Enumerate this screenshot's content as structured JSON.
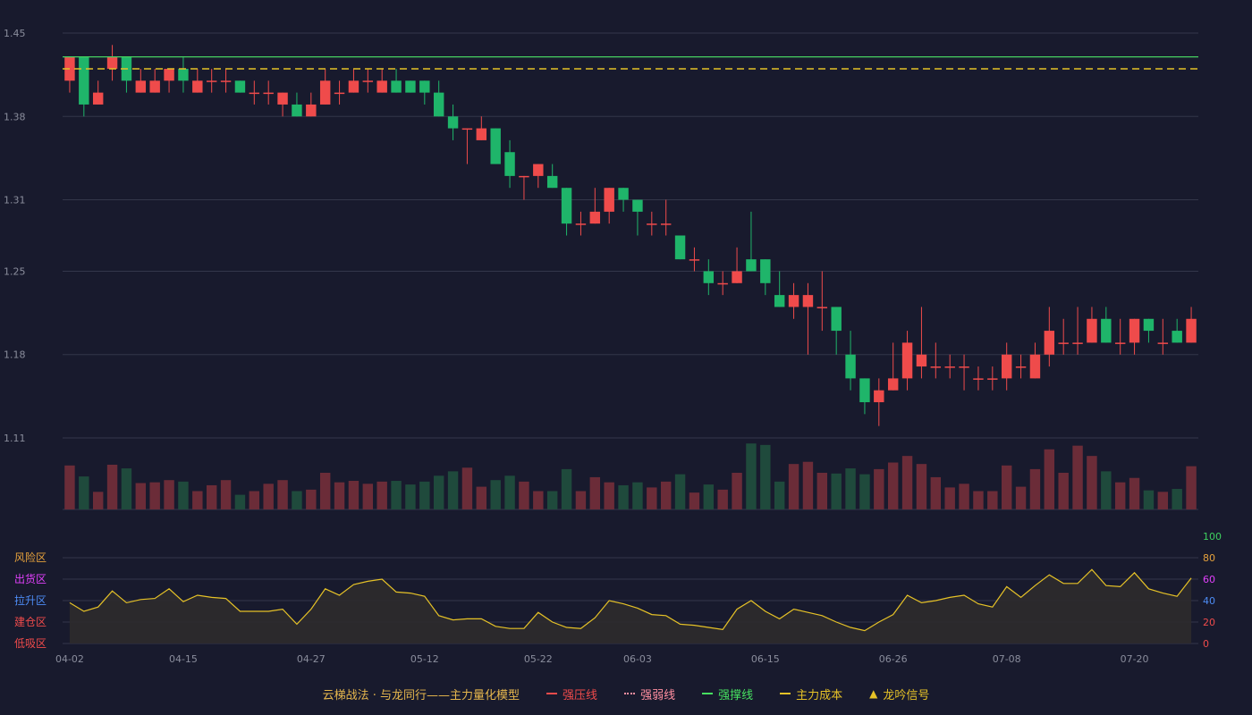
{
  "chart_data": {
    "type": "candlestick",
    "x_dates": [
      "04-02",
      "04-03",
      "04-07",
      "04-08",
      "04-09",
      "04-10",
      "04-11",
      "04-14",
      "04-15",
      "04-16",
      "04-17",
      "04-18",
      "04-21",
      "04-22",
      "04-23",
      "04-24",
      "04-25",
      "04-27",
      "04-28",
      "04-29",
      "04-30",
      "05-06",
      "05-07",
      "05-08",
      "05-09",
      "05-12",
      "05-13",
      "05-14",
      "05-15",
      "05-16",
      "05-19",
      "05-20",
      "05-21",
      "05-22",
      "05-23",
      "05-26",
      "05-27",
      "05-28",
      "05-29",
      "05-30",
      "06-03",
      "06-04",
      "06-05",
      "06-06",
      "06-09",
      "06-10",
      "06-11",
      "06-12",
      "06-13",
      "06-15",
      "06-16",
      "06-17",
      "06-18",
      "06-19",
      "06-20",
      "06-23",
      "06-24",
      "06-25",
      "06-26",
      "06-27",
      "06-30",
      "07-01",
      "07-02",
      "07-03",
      "07-04",
      "07-07",
      "07-08",
      "07-09",
      "07-10",
      "07-11",
      "07-14",
      "07-15",
      "07-16",
      "07-17",
      "07-18",
      "07-20",
      "07-21",
      "07-22",
      "07-23",
      "07-24",
      "07-25",
      "07-28"
    ],
    "x_tick_labels": [
      "04-02",
      "04-15",
      "04-27",
      "05-12",
      "05-22",
      "06-03",
      "06-15",
      "06-26",
      "07-08",
      "07-20"
    ],
    "price_axis": {
      "ticks": [
        1.11,
        1.18,
        1.25,
        1.31,
        1.38,
        1.45
      ],
      "min": 1.11,
      "max": 1.46
    },
    "indicator_axis": {
      "ticks": [
        0,
        20,
        40,
        60,
        80,
        100
      ]
    },
    "zone_labels": [
      "风险区",
      "出货区",
      "拉升区",
      "建仓区",
      "低吸区"
    ],
    "ohlc": [
      [
        1.41,
        1.43,
        1.4,
        1.43
      ],
      [
        1.43,
        1.43,
        1.38,
        1.39
      ],
      [
        1.39,
        1.41,
        1.39,
        1.4
      ],
      [
        1.42,
        1.44,
        1.41,
        1.43
      ],
      [
        1.43,
        1.43,
        1.4,
        1.41
      ],
      [
        1.4,
        1.42,
        1.4,
        1.41
      ],
      [
        1.4,
        1.42,
        1.4,
        1.41
      ],
      [
        1.41,
        1.42,
        1.4,
        1.42
      ],
      [
        1.42,
        1.43,
        1.4,
        1.41
      ],
      [
        1.4,
        1.42,
        1.4,
        1.41
      ],
      [
        1.41,
        1.42,
        1.4,
        1.41
      ],
      [
        1.41,
        1.42,
        1.4,
        1.41
      ],
      [
        1.41,
        1.41,
        1.4,
        1.4
      ],
      [
        1.4,
        1.41,
        1.39,
        1.4
      ],
      [
        1.4,
        1.41,
        1.39,
        1.4
      ],
      [
        1.39,
        1.4,
        1.38,
        1.4
      ],
      [
        1.39,
        1.4,
        1.38,
        1.38
      ],
      [
        1.38,
        1.4,
        1.38,
        1.39
      ],
      [
        1.39,
        1.42,
        1.39,
        1.41
      ],
      [
        1.4,
        1.41,
        1.39,
        1.4
      ],
      [
        1.4,
        1.42,
        1.4,
        1.41
      ],
      [
        1.41,
        1.42,
        1.4,
        1.41
      ],
      [
        1.4,
        1.42,
        1.4,
        1.41
      ],
      [
        1.41,
        1.42,
        1.4,
        1.4
      ],
      [
        1.41,
        1.41,
        1.4,
        1.4
      ],
      [
        1.41,
        1.41,
        1.39,
        1.4
      ],
      [
        1.4,
        1.41,
        1.38,
        1.38
      ],
      [
        1.38,
        1.39,
        1.36,
        1.37
      ],
      [
        1.37,
        1.37,
        1.34,
        1.37
      ],
      [
        1.36,
        1.38,
        1.36,
        1.37
      ],
      [
        1.37,
        1.37,
        1.34,
        1.34
      ],
      [
        1.35,
        1.36,
        1.32,
        1.33
      ],
      [
        1.33,
        1.33,
        1.31,
        1.33
      ],
      [
        1.33,
        1.34,
        1.32,
        1.34
      ],
      [
        1.33,
        1.34,
        1.32,
        1.32
      ],
      [
        1.32,
        1.32,
        1.28,
        1.29
      ],
      [
        1.29,
        1.3,
        1.28,
        1.29
      ],
      [
        1.29,
        1.32,
        1.29,
        1.3
      ],
      [
        1.3,
        1.32,
        1.29,
        1.32
      ],
      [
        1.32,
        1.32,
        1.3,
        1.31
      ],
      [
        1.31,
        1.31,
        1.28,
        1.3
      ],
      [
        1.29,
        1.3,
        1.28,
        1.29
      ],
      [
        1.29,
        1.31,
        1.28,
        1.29
      ],
      [
        1.28,
        1.28,
        1.26,
        1.26
      ],
      [
        1.26,
        1.27,
        1.25,
        1.26
      ],
      [
        1.25,
        1.26,
        1.23,
        1.24
      ],
      [
        1.24,
        1.25,
        1.23,
        1.24
      ],
      [
        1.24,
        1.27,
        1.24,
        1.25
      ],
      [
        1.26,
        1.3,
        1.25,
        1.25
      ],
      [
        1.26,
        1.26,
        1.23,
        1.24
      ],
      [
        1.23,
        1.25,
        1.22,
        1.22
      ],
      [
        1.22,
        1.24,
        1.21,
        1.23
      ],
      [
        1.22,
        1.24,
        1.18,
        1.23
      ],
      [
        1.22,
        1.25,
        1.2,
        1.22
      ],
      [
        1.22,
        1.22,
        1.18,
        1.2
      ],
      [
        1.18,
        1.2,
        1.15,
        1.16
      ],
      [
        1.16,
        1.16,
        1.13,
        1.14
      ],
      [
        1.14,
        1.16,
        1.12,
        1.15
      ],
      [
        1.15,
        1.19,
        1.15,
        1.16
      ],
      [
        1.16,
        1.2,
        1.15,
        1.19
      ],
      [
        1.17,
        1.22,
        1.16,
        1.18
      ],
      [
        1.17,
        1.19,
        1.16,
        1.17
      ],
      [
        1.17,
        1.18,
        1.16,
        1.17
      ],
      [
        1.17,
        1.18,
        1.15,
        1.17
      ],
      [
        1.16,
        1.17,
        1.15,
        1.16
      ],
      [
        1.16,
        1.17,
        1.15,
        1.16
      ],
      [
        1.16,
        1.19,
        1.15,
        1.18
      ],
      [
        1.17,
        1.18,
        1.16,
        1.17
      ],
      [
        1.16,
        1.19,
        1.16,
        1.18
      ],
      [
        1.18,
        1.22,
        1.17,
        1.2
      ],
      [
        1.19,
        1.21,
        1.18,
        1.19
      ],
      [
        1.19,
        1.22,
        1.18,
        1.19
      ],
      [
        1.19,
        1.22,
        1.19,
        1.21
      ],
      [
        1.21,
        1.22,
        1.19,
        1.19
      ],
      [
        1.19,
        1.21,
        1.18,
        1.19
      ],
      [
        1.19,
        1.21,
        1.18,
        1.21
      ],
      [
        1.21,
        1.21,
        1.19,
        1.2
      ],
      [
        1.19,
        1.21,
        1.18,
        1.19
      ],
      [
        1.2,
        1.21,
        1.19,
        1.19
      ],
      [
        1.19,
        1.22,
        1.19,
        1.21
      ]
    ],
    "volume": [
      60,
      45,
      24,
      61,
      56,
      36,
      37,
      40,
      38,
      25,
      33,
      40,
      20,
      25,
      35,
      40,
      25,
      27,
      50,
      37,
      39,
      35,
      38,
      39,
      34,
      38,
      46,
      52,
      57,
      31,
      40,
      46,
      38,
      25,
      25,
      55,
      25,
      44,
      37,
      33,
      37,
      30,
      38,
      48,
      23,
      34,
      27,
      50,
      90,
      88,
      38,
      62,
      65,
      50,
      49,
      56,
      48,
      55,
      64,
      73,
      62,
      44,
      30,
      35,
      25,
      25,
      60,
      31,
      55,
      82,
      50,
      87,
      73,
      52,
      37,
      43,
      26,
      24,
      28,
      59
    ],
    "indicator": [
      38,
      30,
      34,
      49,
      38,
      41,
      42,
      51,
      39,
      45,
      43,
      42,
      30,
      30,
      30,
      32,
      18,
      32,
      51,
      45,
      55,
      58,
      60,
      48,
      47,
      44,
      26,
      22,
      23,
      23,
      16,
      14,
      14,
      29,
      20,
      15,
      14,
      24,
      40,
      37,
      33,
      27,
      26,
      18,
      17,
      15,
      13,
      32,
      40,
      30,
      23,
      32,
      29,
      26,
      20,
      15,
      12,
      20,
      27,
      45,
      38,
      40,
      43,
      45,
      37,
      34,
      53,
      43,
      54,
      64,
      56,
      56,
      69,
      54,
      53,
      66,
      51,
      47,
      44,
      61
    ],
    "line_levels": {
      "强撑线": 1.43,
      "主力成本": 1.42
    },
    "colors": {
      "up": "#ef4b4b",
      "down": "#1fb56a",
      "vol_up": "#6b2c38",
      "vol_down": "#1f4a3c",
      "indicator": "#e6c227",
      "indicator_fill": "#2e2b2c",
      "support": "#46d060",
      "cost": "#e6c227",
      "grid": "#33364a",
      "axis_text": "#8a8d9c",
      "green_tick": "#3ed15f",
      "orange_tick": "#e6a23c",
      "magenta_tick": "#e040fb",
      "blue_tick": "#4d8cf5",
      "red_tick": "#ef4b4b"
    }
  },
  "legend": {
    "title": "云梯战法 · 与龙同行——主力量化模型",
    "items": [
      {
        "label": "强压线",
        "color": "#ef4b4b",
        "style": "solid"
      },
      {
        "label": "强弱线",
        "color": "#ff8fa0",
        "style": "dotted"
      },
      {
        "label": "强撑线",
        "color": "#46e060",
        "style": "solid"
      },
      {
        "label": "主力成本",
        "color": "#e6c227",
        "style": "dashed"
      },
      {
        "label": "龙吟信号",
        "color": "#e6c227",
        "style": "triangle"
      }
    ]
  }
}
